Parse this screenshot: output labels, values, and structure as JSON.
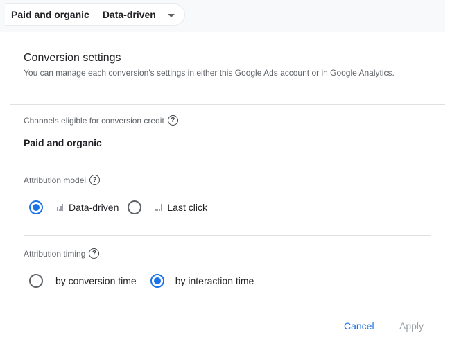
{
  "header": {
    "chip_channels": "Paid and organic",
    "chip_model": "Data-driven"
  },
  "settings": {
    "title": "Conversion settings",
    "description": "You can manage each conversion's settings in either this Google Ads account or in Google Analytics."
  },
  "channels": {
    "label": "Channels eligible for conversion credit",
    "value": "Paid and organic"
  },
  "attribution_model": {
    "label": "Attribution model",
    "options": [
      {
        "label": "Data-driven",
        "selected": true
      },
      {
        "label": "Last click",
        "selected": false
      }
    ]
  },
  "attribution_timing": {
    "label": "Attribution timing",
    "options": [
      {
        "label": "by conversion time",
        "selected": false
      },
      {
        "label": "by interaction time",
        "selected": true
      }
    ]
  },
  "actions": {
    "cancel": "Cancel",
    "apply": "Apply"
  },
  "colors": {
    "accent": "#1a73e8",
    "disabled": "#9aa0a6"
  }
}
